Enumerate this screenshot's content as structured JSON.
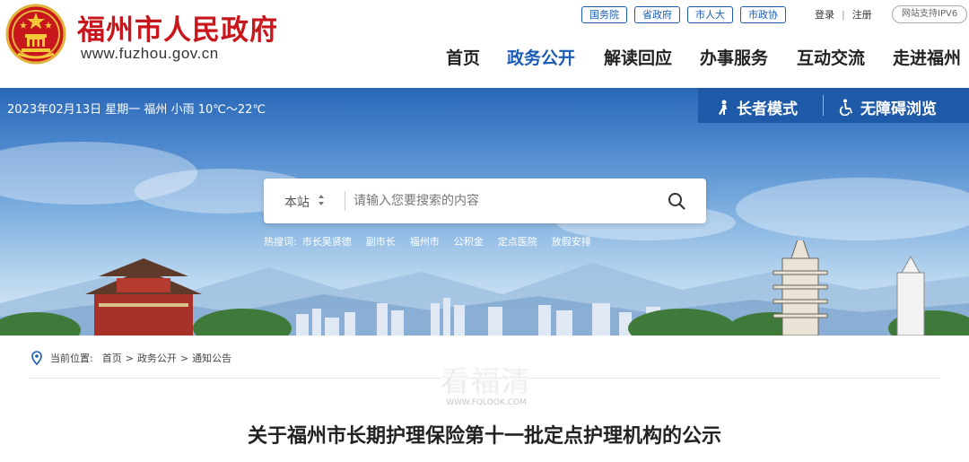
{
  "header": {
    "title": "福州市人民政府",
    "url": "www.fuzhou.gov.cn",
    "top_links": [
      "国务院",
      "省政府",
      "市人大",
      "市政协"
    ],
    "login": "登录",
    "register": "注册",
    "ipv6": "网站支持IPV6",
    "nav": [
      "首页",
      "政务公开",
      "解读回应",
      "办事服务",
      "互动交流",
      "走进福州"
    ],
    "active_nav": "政务公开"
  },
  "banner": {
    "weather": "2023年02月13日 星期一 福州 小雨 10℃～22℃",
    "elder_mode": "长者模式",
    "accessible": "无障碍浏览",
    "search": {
      "scope": "本站",
      "placeholder": "请输入您要搜索的内容"
    },
    "hot_label": "热搜词:",
    "hot_words": [
      "市长吴贤德",
      "副市长",
      "福州市",
      "公积金",
      "定点医院",
      "放假安排"
    ]
  },
  "content": {
    "crumb_label": "当前位置:",
    "crumbs": [
      "首页",
      "政务公开",
      "通知公告"
    ],
    "title": "关于福州市长期护理保险第十一批定点护理机构的公示"
  },
  "watermark": {
    "main": "看福清",
    "sub": "WWW.FQLOOK.COM"
  },
  "colors": {
    "brand_red": "#c8161d",
    "accent_blue": "#1a5bb5",
    "access_bar": "#1f5aa8"
  }
}
